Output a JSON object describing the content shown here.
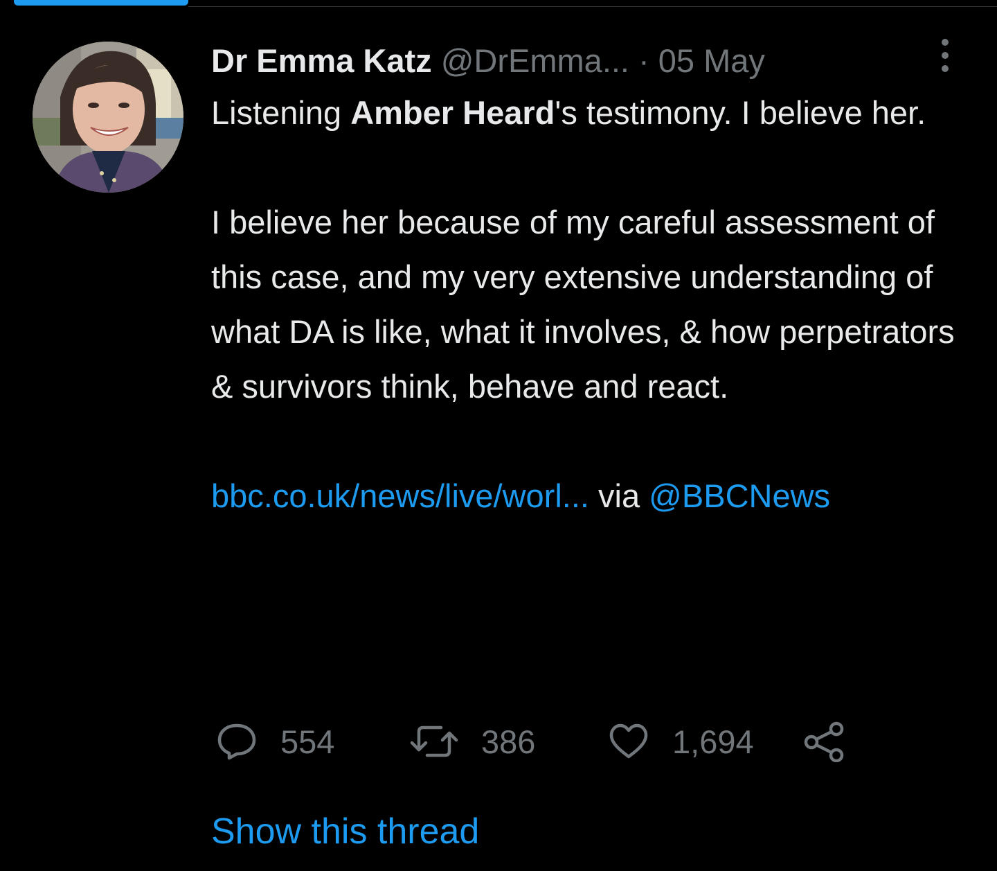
{
  "tweet": {
    "author_name": "Dr Emma Katz",
    "handle": "@DrEmma...",
    "separator": "·",
    "date": "05 May",
    "text": {
      "p1_prefix": "Listening ",
      "p1_bold": "Amber Heard",
      "p1_suffix": "'s testimony. I believe her.",
      "p2": "I believe her because of my careful assessment of this case, and my very extensive understanding of what DA is like, what it involves, & how perpetrators & survivors think, behave and react.",
      "link": "bbc.co.uk/news/live/worl...",
      "via": " via ",
      "mention": "@BBCNews"
    },
    "actions": {
      "replies": "554",
      "retweets": "386",
      "likes": "1,694"
    },
    "show_thread": "Show this thread"
  },
  "colors": {
    "background": "#000000",
    "text": "#e7e9ea",
    "secondary": "#71767b",
    "accent": "#1d9bf0"
  },
  "icons": [
    "more-icon",
    "reply-icon",
    "retweet-icon",
    "like-icon",
    "share-icon"
  ]
}
